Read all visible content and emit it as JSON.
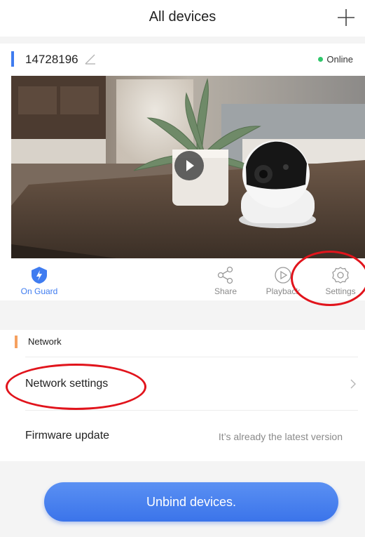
{
  "header": {
    "title": "All devices"
  },
  "device": {
    "name": "14728196",
    "status": "Online"
  },
  "actions": {
    "guard_label": "On Guard",
    "share_label": "Share",
    "playback_label": "Playback",
    "settings_label": "Settings"
  },
  "network": {
    "section_title": "Network",
    "network_settings_label": "Network settings",
    "firmware_label": "Firmware update",
    "firmware_status": "It’s already the latest version"
  },
  "unbind": {
    "label": "Unbind devices."
  },
  "colors": {
    "accent": "#3f7cf0",
    "online": "#2fc76b",
    "section_accent": "#f5a05f",
    "annotation": "#e1141c"
  },
  "icons": [
    "add-icon",
    "edit-icon",
    "play-icon",
    "shield-icon",
    "share-icon",
    "playback-icon",
    "gear-icon",
    "chevron-right-icon"
  ]
}
